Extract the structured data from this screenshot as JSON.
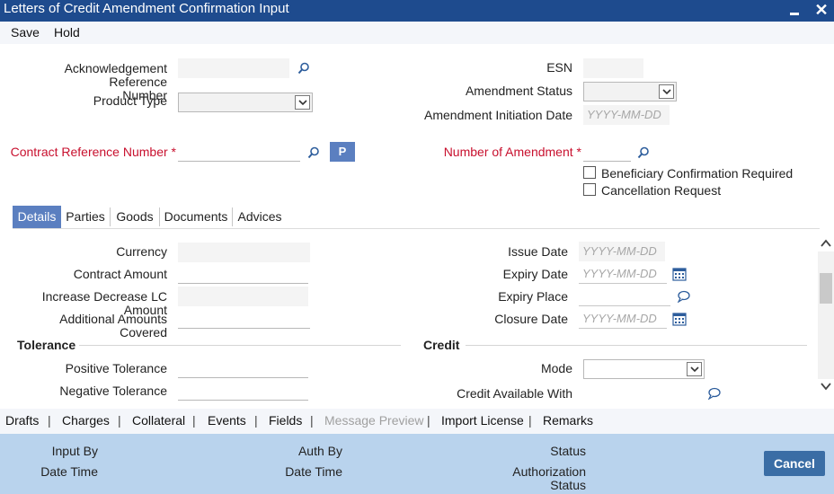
{
  "window": {
    "title": "Letters of Credit Amendment Confirmation Input",
    "minimize_glyph": "–",
    "close_glyph": "✕"
  },
  "toolbar": {
    "save_label": "Save",
    "hold_label": "Hold"
  },
  "header": {
    "ack_ref_label_line1": "Acknowledgement Reference",
    "ack_ref_label_line2": "Number",
    "ack_ref_value": "",
    "product_type_label": "Product Type",
    "product_type_value": "",
    "esn_label": "ESN",
    "esn_value": "",
    "amendment_status_label": "Amendment Status",
    "amendment_status_value": "",
    "amendment_initiation_date_label": "Amendment Initiation Date",
    "amendment_initiation_date_placeholder": "YYYY-MM-DD",
    "contract_ref_label": "Contract Reference Number",
    "contract_ref_value": "",
    "required_marker": "*",
    "p_button_label": "P",
    "num_amendment_label": "Number of Amendment",
    "num_amendment_value": "",
    "beneficiary_confirmation_label": "Beneficiary Confirmation Required",
    "beneficiary_confirmation_checked": false,
    "cancellation_request_label": "Cancellation Request",
    "cancellation_request_checked": false
  },
  "tabs": [
    {
      "label": "Details",
      "active": true
    },
    {
      "label": "Parties",
      "active": false
    },
    {
      "label": "Goods",
      "active": false
    },
    {
      "label": "Documents",
      "active": false
    },
    {
      "label": "Advices",
      "active": false
    }
  ],
  "details": {
    "currency_label": "Currency",
    "currency_value": "",
    "contract_amount_label": "Contract Amount",
    "contract_amount_value": "",
    "increase_decrease_label": "Increase Decrease LC Amount",
    "increase_decrease_value": "",
    "additional_amounts_label": "Additional Amounts Covered",
    "additional_amounts_value": "",
    "issue_date_label": "Issue Date",
    "issue_date_placeholder": "YYYY-MM-DD",
    "expiry_date_label": "Expiry Date",
    "expiry_date_placeholder": "YYYY-MM-DD",
    "expiry_place_label": "Expiry Place",
    "expiry_place_value": "",
    "closure_date_label": "Closure Date",
    "closure_date_placeholder": "YYYY-MM-DD",
    "tolerance_section": "Tolerance",
    "positive_tolerance_label": "Positive Tolerance",
    "positive_tolerance_value": "",
    "negative_tolerance_label": "Negative Tolerance",
    "negative_tolerance_value": "",
    "credit_section": "Credit",
    "mode_label": "Mode",
    "mode_value": "",
    "credit_available_with_label": "Credit Available With",
    "credit_available_with_value": ""
  },
  "bottom_nav": [
    {
      "label": "Drafts",
      "enabled": true
    },
    {
      "label": "Charges",
      "enabled": true
    },
    {
      "label": "Collateral",
      "enabled": true
    },
    {
      "label": "Events",
      "enabled": true
    },
    {
      "label": "Fields",
      "enabled": true
    },
    {
      "label": "Message Preview",
      "enabled": false
    },
    {
      "label": "Import License",
      "enabled": true
    },
    {
      "label": "Remarks",
      "enabled": true
    }
  ],
  "nav_separator": "|",
  "footer": {
    "input_by_label": "Input By",
    "date_time_label_1": "Date Time",
    "auth_by_label": "Auth By",
    "date_time_label_2": "Date Time",
    "status_label": "Status",
    "authorization_status_line1": "Authorization",
    "authorization_status_line2": "Status",
    "cancel_label": "Cancel"
  },
  "icons": {
    "lookup": "magnifier-icon",
    "calendar": "calendar-icon",
    "narrative": "speech-bubble-icon",
    "dropdown": "chevron-down-icon",
    "scroll_up": "chevron-up-icon",
    "scroll_down": "chevron-down-icon"
  },
  "colors": {
    "title_bar": "#1e4b8e",
    "active_tab": "#5b7fc0",
    "required_label": "#c8102e",
    "footer_bg": "#b9d3ed",
    "cancel_button": "#3a6da5"
  }
}
